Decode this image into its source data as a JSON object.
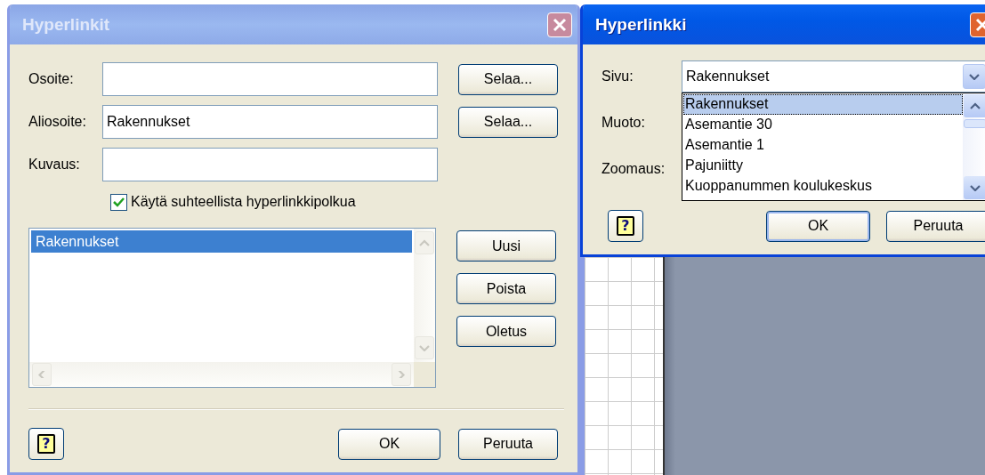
{
  "left_dialog": {
    "title": "Hyperlinkit",
    "active": false,
    "fields": [
      {
        "label": "Osoite:",
        "button": "Selaa..."
      },
      {
        "label": "Aliosoite:",
        "value": "Rakennukset",
        "button": "Selaa..."
      },
      {
        "label": "Kuvaus:"
      }
    ],
    "checkbox": {
      "label": "Käytä suhteellista hyperlinkkipolkua",
      "checked": true
    },
    "list": [
      {
        "label": "Rakennukset",
        "selected": true
      }
    ],
    "side_buttons": [
      "Uusi",
      "Poista",
      "Oletus"
    ],
    "help": "?",
    "buttons": [
      {
        "label": "OK",
        "default": false
      },
      {
        "label": "Peruuta",
        "default": false
      }
    ]
  },
  "right_dialog": {
    "title": "Hyperlinkki",
    "active": true,
    "labels": [
      "Sivu:",
      "Muoto:",
      "Zoomaus:"
    ],
    "combo": {
      "value": "Rakennukset",
      "expanded": true,
      "options": [
        {
          "label": "Rakennukset",
          "selected": true
        },
        {
          "label": "Asemantie 30",
          "selected": false
        },
        {
          "label": "Asemantie 1",
          "selected": false
        },
        {
          "label": "Pajuniitty",
          "selected": false
        },
        {
          "label": "Kuoppanummen koulukeskus",
          "selected": false
        }
      ]
    },
    "help": "?",
    "buttons": [
      {
        "label": "OK",
        "default": true
      },
      {
        "label": "Peruuta",
        "default": false
      }
    ]
  }
}
